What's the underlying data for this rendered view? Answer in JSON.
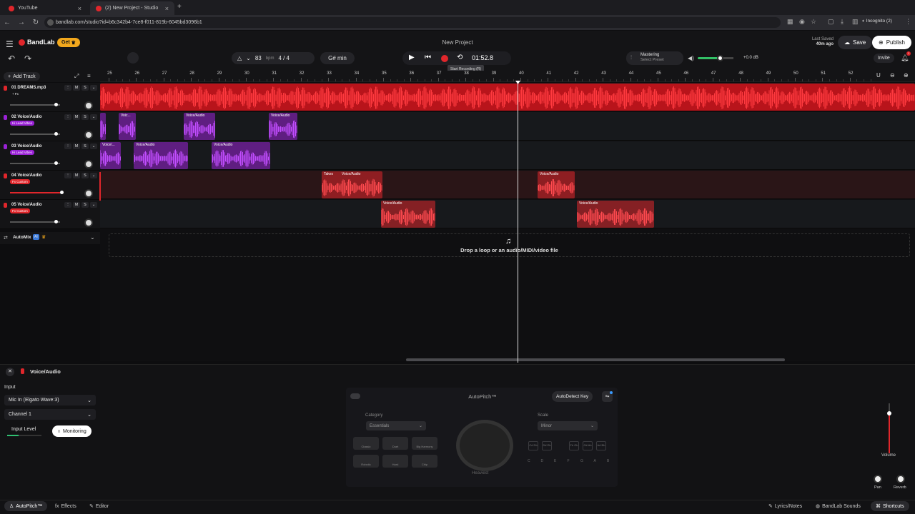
{
  "browser": {
    "tabs": [
      {
        "title": "YouTube"
      },
      {
        "title": "(2) New Project - Studio"
      }
    ],
    "url": "bandlab.com/studio?id=b6c342b4-7ce8-f011-819b-6045bd3096b1",
    "profile": "Incognito (2)"
  },
  "header": {
    "brand": "BandLab",
    "get_label": "Get",
    "project_title": "New Project",
    "last_saved_label": "Last Saved",
    "last_saved_value": "40m ago",
    "save_label": "Save",
    "publish_label": "Publish",
    "invite_label": "Invite",
    "notification_count": "1"
  },
  "transport": {
    "bpm": "83",
    "bpm_unit": "bpm",
    "time_sig": "4 / 4",
    "key": "G# min",
    "time": "01:52.8",
    "tooltip": "Start Recording (R)",
    "mastering_label": "Mastering",
    "mastering_preset": "Select Preset",
    "master_db": "+0.0 dB"
  },
  "tracks_panel": {
    "add_track_label": "Add Track",
    "automix_label": "AutoMix",
    "automix_badge": "AI"
  },
  "ruler": {
    "bars": [
      "25",
      "26",
      "27",
      "28",
      "29",
      "30",
      "31",
      "32",
      "33",
      "34",
      "35",
      "36",
      "37",
      "38",
      "39",
      "40",
      "41",
      "42",
      "43",
      "44",
      "45",
      "46",
      "47",
      "48",
      "49",
      "50",
      "51",
      "52"
    ]
  },
  "tracks": [
    {
      "name": "01  DREAMS.mp3",
      "tag": "+ Fx",
      "mute": "M",
      "solo": "S",
      "color": "#e0262b",
      "clips": []
    },
    {
      "name": "02  Voice/Audio",
      "tag": "Hi Lead Vibes",
      "mute": "M",
      "solo": "S",
      "color": "#9a22d6",
      "clips": [
        {
          "label": ""
        },
        {
          "label": "Voic..."
        },
        {
          "label": "Voice/Audio"
        },
        {
          "label": "Voice/Audio"
        }
      ]
    },
    {
      "name": "03  Voice/Audio",
      "tag": "Hi Lead Vibes",
      "mute": "M",
      "solo": "S",
      "color": "#9a22d6",
      "clips": [
        {
          "label": "Voice/..."
        },
        {
          "label": "Voice/Audio"
        },
        {
          "label": "Voice/Audio"
        }
      ]
    },
    {
      "name": "04  Voice/Audio",
      "tag": "Fx Custom",
      "mute": "M",
      "solo": "S",
      "color": "#e0262b",
      "clips": [
        {
          "label": "Takes"
        },
        {
          "label": "Voice/Audio"
        },
        {
          "label": "Voice/Audio"
        }
      ]
    },
    {
      "name": "05  Voice/Audio",
      "tag": "Fx Custom",
      "mute": "M",
      "solo": "S",
      "color": "#e0262b",
      "clips": [
        {
          "label": "Voice/Audio"
        },
        {
          "label": "Voice/Audio"
        }
      ]
    }
  ],
  "dropzone": {
    "text": "Drop a loop or an audio/MIDI/video file"
  },
  "bottom_panel": {
    "track_title": "Voice/Audio",
    "input_label": "Input",
    "input_device": "Mic In (Elgato Wave:3)",
    "channel": "Channel 1",
    "input_level_label": "Input Level",
    "monitoring_label": "Monitoring",
    "autopitch": {
      "title": "AutoPitch™",
      "autodetect_label": "AutoDetect Key",
      "category_label": "Category",
      "category_value": "Essentials",
      "scale_label": "Scale",
      "scale_value": "Minor",
      "knob_label": "Heaviest",
      "effects": [
        "Classic",
        "Duet",
        "Big Harmony",
        "Robotic",
        "Hard",
        "Chip"
      ],
      "keys_top": [
        "C#\nDb",
        "D#\nEb",
        "F#\nGb",
        "G#\nAb",
        "A#\nBb"
      ],
      "keys_bottom": [
        "C",
        "D",
        "E",
        "F",
        "G",
        "A",
        "B"
      ]
    },
    "volume_label": "Volume",
    "pan_label": "Pan",
    "reverb_label": "Reverb"
  },
  "footer": {
    "tabs": [
      {
        "label": "AutoPitch™"
      },
      {
        "label": "Effects"
      },
      {
        "label": "Editor"
      }
    ],
    "lyrics_label": "Lyrics/Notes",
    "sounds_label": "BandLab Sounds",
    "shortcuts_label": "Shortcuts"
  },
  "colors": {
    "accent": "#e0262b",
    "purple": "#9a22d6",
    "background": "#0d0d0f"
  }
}
